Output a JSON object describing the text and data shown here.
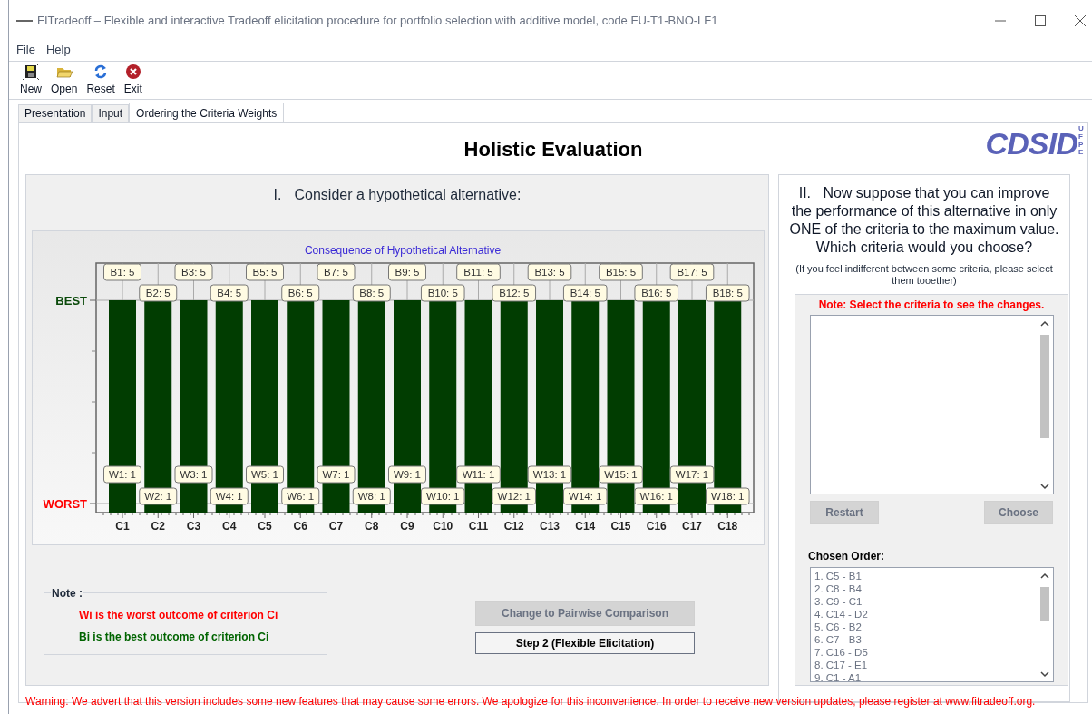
{
  "window": {
    "title": "FITradeoff – Flexible and interactive Tradeoff elicitation procedure for portfolio selection with additive model, code FU-T1-BNO-LF1"
  },
  "menu": [
    "File",
    "Help"
  ],
  "toolbar": [
    {
      "kind": "new",
      "label": "New"
    },
    {
      "kind": "open",
      "label": "Open"
    },
    {
      "kind": "reset",
      "label": "Reset"
    },
    {
      "kind": "exit",
      "label": "Exit"
    }
  ],
  "tabs": [
    {
      "label": "Presentation",
      "selected": false
    },
    {
      "label": "Input",
      "selected": false
    },
    {
      "label": "Ordering the Criteria Weights",
      "selected": true
    }
  ],
  "heading": "Holistic Evaluation",
  "logo": {
    "text": "CDSID",
    "side": "UFPE"
  },
  "left_panel": {
    "prompt_number": "I.",
    "prompt": "Consider a hypothetical alternative:",
    "consequence_chart": {
      "title": "Consequence of Hypothetical Alternative",
      "top_label": "BEST",
      "bottom_label": "WORST",
      "categories": [
        "C1",
        "C2",
        "C3",
        "C4",
        "C5",
        "C6",
        "C7",
        "C8",
        "C9",
        "C10",
        "C11",
        "C12",
        "C13",
        "C14",
        "C15",
        "C16",
        "C17",
        "C18"
      ],
      "bar_labels": [
        {
          "best": "B1: 5",
          "worst": "W1: 1"
        },
        {
          "best": "B2: 5",
          "worst": "W2: 1"
        },
        {
          "best": "B3: 5",
          "worst": "W3: 1"
        },
        {
          "best": "B4: 5",
          "worst": "W4: 1"
        },
        {
          "best": "B5: 5",
          "worst": "W5: 1"
        },
        {
          "best": "B6: 5",
          "worst": "W6: 1"
        },
        {
          "best": "B7: 5",
          "worst": "W7: 1"
        },
        {
          "best": "B8: 5",
          "worst": "W8: 1"
        },
        {
          "best": "B9: 5",
          "worst": "W9: 1"
        },
        {
          "best": "B10: 5",
          "worst": "W10: 1"
        },
        {
          "best": "B11: 5",
          "worst": "W11: 1"
        },
        {
          "best": "B12: 5",
          "worst": "W12: 1"
        },
        {
          "best": "B13: 5",
          "worst": "W13: 1"
        },
        {
          "best": "B14: 5",
          "worst": "W14: 1"
        },
        {
          "best": "B15: 5",
          "worst": "W15: 1"
        },
        {
          "best": "B16: 5",
          "worst": "W16: 1"
        },
        {
          "best": "B17: 5",
          "worst": "W17: 1"
        },
        {
          "best": "B18: 5",
          "worst": "W18: 1"
        }
      ]
    },
    "note": {
      "title": "Note :",
      "lines": [
        {
          "text": "Wi is the worst outcome of criterion Ci",
          "color": "#ff0000"
        },
        {
          "text": "Bi is the best outcome of criterion Ci",
          "color": "#006400"
        }
      ]
    },
    "buttons": [
      {
        "label": "Change to Pairwise Comparison",
        "disabled": true
      },
      {
        "label": "Step 2 (Flexible Elicitation)",
        "disabled": false
      }
    ]
  },
  "right_panel": {
    "question": "II.   Now suppose that you can improve the performance of this alternative in only ONE of the criteria to the maximum value. Which criteria would you choose?",
    "hint": "(If you feel indifferent between some criteria, please select them tooether)",
    "note": "Note: Select the criteria to see the changes.",
    "buttons": [
      {
        "label": "Restart",
        "disabled": true
      },
      {
        "label": "Choose",
        "disabled": true
      }
    ],
    "chosen_order_label": "Chosen Order:",
    "chosen_order": [
      "1. C5 - B1",
      "2. C8 - B4",
      "3. C9 - C1",
      "4. C14 - D2",
      "5. C6 - B2",
      "6. C7 - B3",
      "7. C16 - D5",
      "8. C17 - E1",
      "9. C1 - A1"
    ]
  },
  "warning": "Warning: We advert that this version includes some new features that may cause some errors. We apologize for this inconvenience. In order to receive new version updates, please register at www.fitradeoff.org."
}
